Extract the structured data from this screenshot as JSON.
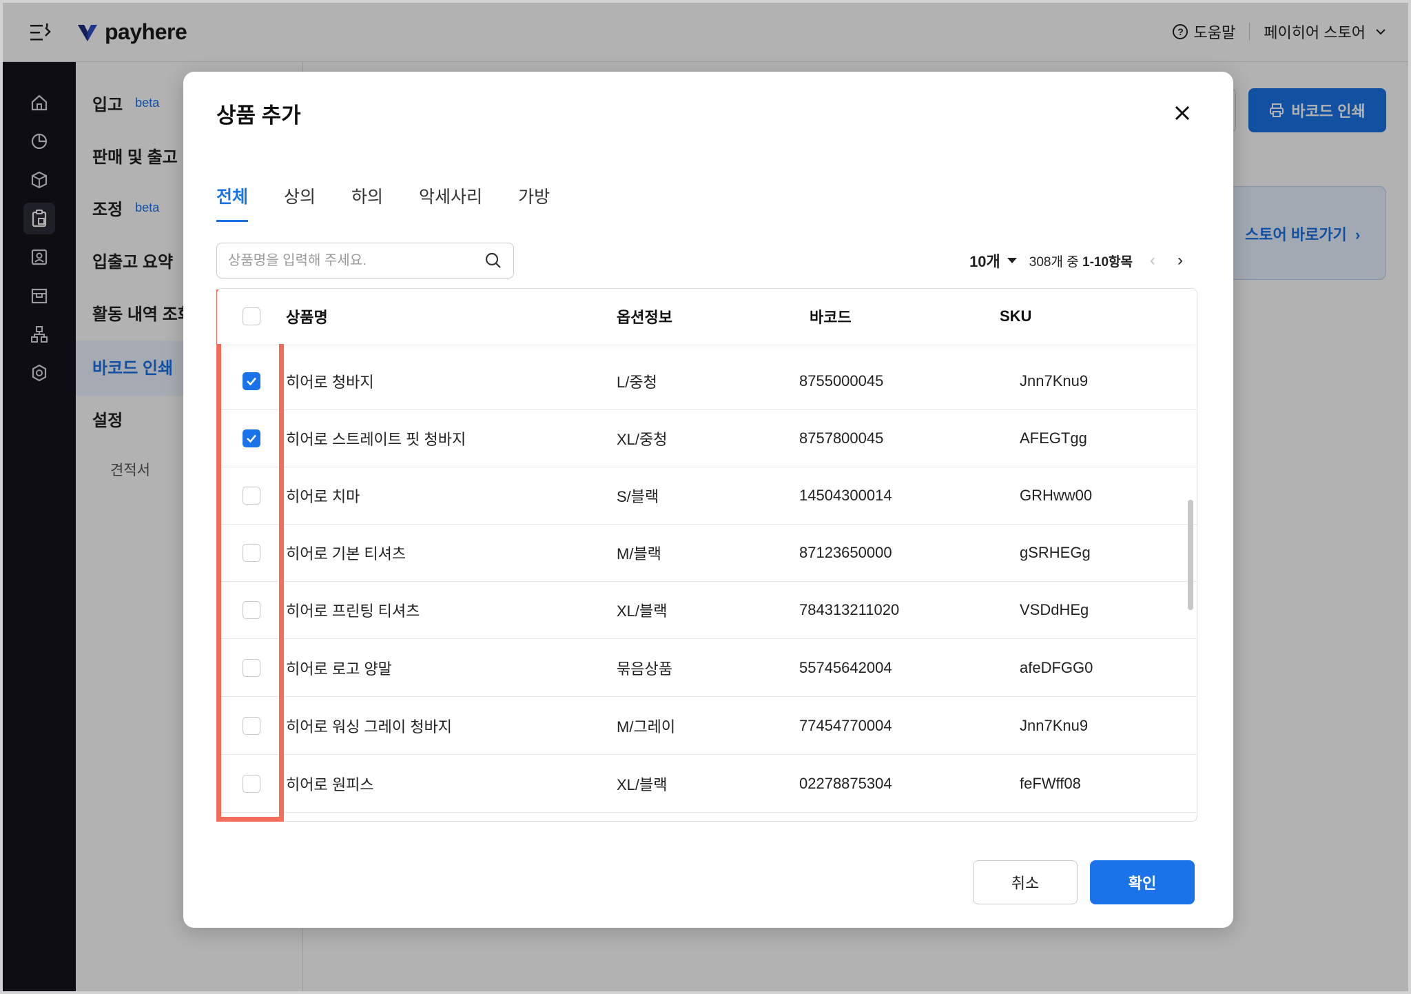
{
  "app": {
    "brand": "payhere",
    "help_label": "도움말",
    "store_name": "페이히어 스토어"
  },
  "sidebar": {
    "items": [
      {
        "label": "입고",
        "badge": "beta"
      },
      {
        "label": "판매 및 출고",
        "badge": ""
      },
      {
        "label": "조정",
        "badge": "beta"
      },
      {
        "label": "입출고 요약",
        "badge": ""
      },
      {
        "label": "활동 내역 조회",
        "badge": ""
      },
      {
        "label": "바코드 인쇄",
        "badge": ""
      },
      {
        "label": "설정",
        "badge": ""
      }
    ],
    "sub_item": "견적서",
    "active": "바코드 인쇄"
  },
  "page": {
    "print_button": "바코드 인쇄",
    "store_link": "스토어 바로가기"
  },
  "modal": {
    "title": "상품 추가",
    "tabs": [
      "전체",
      "상의",
      "하의",
      "악세사리",
      "가방"
    ],
    "active_tab": "전체",
    "search_placeholder": "상품명을 입력해 주세요.",
    "per_page": "10개",
    "count_prefix": "308개 중 ",
    "count_range": "1-10항목",
    "columns": [
      "상품명",
      "옵션정보",
      "바코드",
      "SKU"
    ],
    "rows": [
      {
        "checked": true,
        "name": "히어로 청바지",
        "option": "L/중청",
        "barcode": "8755000045",
        "sku": "Jnn7Knu9"
      },
      {
        "checked": true,
        "name": "히어로 스트레이트 핏 청바지",
        "option": "XL/중청",
        "barcode": "8757800045",
        "sku": "AFEGTgg"
      },
      {
        "checked": false,
        "name": "히어로 치마",
        "option": "S/블랙",
        "barcode": "14504300014",
        "sku": "GRHww00"
      },
      {
        "checked": false,
        "name": "히어로 기본 티셔츠",
        "option": "M/블랙",
        "barcode": "87123650000",
        "sku": "gSRHEGg"
      },
      {
        "checked": false,
        "name": "히어로 프린팅 티셔츠",
        "option": "XL/블랙",
        "barcode": "784313211020",
        "sku": "VSDdHEg"
      },
      {
        "checked": false,
        "name": "히어로 로고 양말",
        "option": "묶음상품",
        "barcode": "55745642004",
        "sku": "afeDFGG0"
      },
      {
        "checked": false,
        "name": "히어로 워싱 그레이 청바지",
        "option": "M/그레이",
        "barcode": "77454770004",
        "sku": "Jnn7Knu9"
      },
      {
        "checked": false,
        "name": "히어로 원피스",
        "option": "XL/블랙",
        "barcode": "02278875304",
        "sku": "feFWff08"
      }
    ],
    "cancel_label": "취소",
    "confirm_label": "확인"
  },
  "colors": {
    "accent": "#1a73e8",
    "highlight": "#f26d5b",
    "rail_bg": "#15151b"
  }
}
